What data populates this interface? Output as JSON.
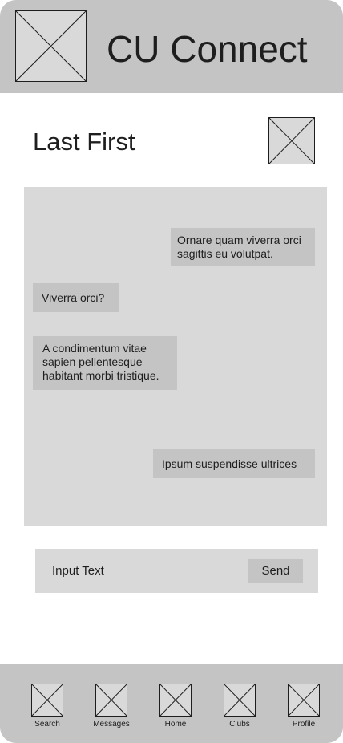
{
  "header": {
    "app_title": "CU Connect",
    "logo_icon": "image-placeholder-icon"
  },
  "conversation": {
    "contact_name": "Last First",
    "contact_avatar_icon": "image-placeholder-icon"
  },
  "messages": [
    {
      "sender": "other",
      "text": "Ornare quam viverra orci sagittis eu volutpat."
    },
    {
      "sender": "me",
      "text": "Viverra orci?"
    },
    {
      "sender": "me",
      "text": "A condimentum vitae sapien pellentesque habitant morbi tristique."
    },
    {
      "sender": "other",
      "text": "Ipsum suspendisse ultrices"
    }
  ],
  "composer": {
    "input_text": "Input Text",
    "send_label": "Send"
  },
  "nav": {
    "items": [
      {
        "label": "Search",
        "icon": "image-placeholder-icon"
      },
      {
        "label": "Messages",
        "icon": "image-placeholder-icon"
      },
      {
        "label": "Home",
        "icon": "image-placeholder-icon"
      },
      {
        "label": "Clubs",
        "icon": "image-placeholder-icon"
      },
      {
        "label": "Profile",
        "icon": "image-placeholder-icon"
      }
    ]
  },
  "colors": {
    "bar_gray": "#c4c4c4",
    "panel_gray": "#d9d9d9",
    "text": "#1e1e1e"
  }
}
